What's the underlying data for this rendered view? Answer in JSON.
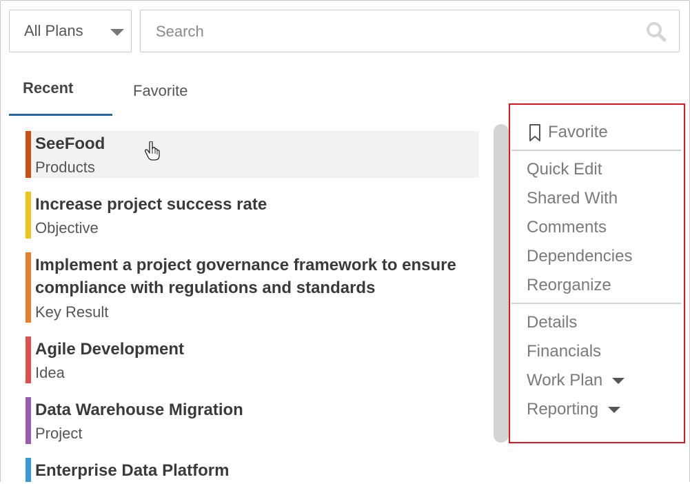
{
  "filters": {
    "plan_select": "All Plans",
    "search_placeholder": "Search"
  },
  "tabs": [
    {
      "label": "Recent",
      "active": true
    },
    {
      "label": "Favorite",
      "active": false
    }
  ],
  "items": [
    {
      "title": "SeeFood",
      "type": "Products",
      "color": "#c94f16"
    },
    {
      "title": "Increase project success rate",
      "type": "Objective",
      "color": "#efc41b"
    },
    {
      "title_line1": "Implement a project governance framework to ensure",
      "title_line2": "compliance with regulations and standards",
      "type": "Key Result",
      "color": "#e67e2e"
    },
    {
      "title": "Agile Development",
      "type": "Idea",
      "color": "#e04e4e"
    },
    {
      "title": "Data Warehouse Migration",
      "type": "Project",
      "color": "#9b59b6"
    },
    {
      "title": "Enterprise Data Platform",
      "type": "",
      "color": "#3a9ad9"
    }
  ],
  "actions": {
    "favorite": "Favorite",
    "group1": [
      "Quick Edit",
      "Shared With",
      "Comments",
      "Dependencies",
      "Reorganize"
    ],
    "group2": [
      "Details",
      "Financials",
      "Work Plan",
      "Reporting"
    ]
  },
  "icons": {
    "search": "search-icon",
    "bookmark": "bookmark-icon",
    "cursor": "hand-cursor-icon"
  }
}
